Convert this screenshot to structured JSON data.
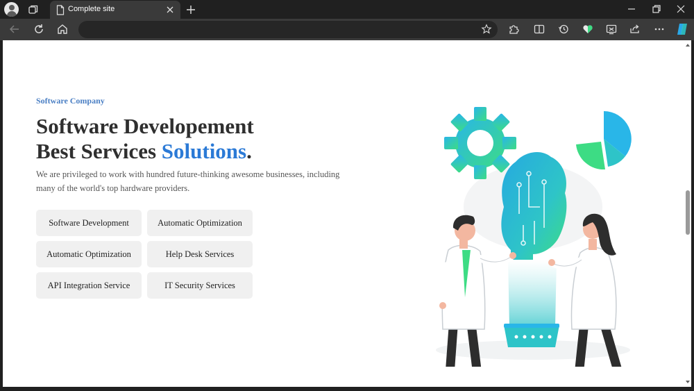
{
  "browser": {
    "tab_title": "Complete site",
    "address_value": ""
  },
  "hero": {
    "eyebrow": "Software Company",
    "heading_line1": "Software Developement",
    "heading_line2_prefix": "Best Services ",
    "heading_line2_accent": "Solutions",
    "heading_line2_suffix": ".",
    "description": "We are privileged to work with hundred future-thinking awesome businesses, including many of the world's top hardware providers."
  },
  "services": [
    "Software Development",
    "Automatic Optimization",
    "Automatic Optimization",
    "Help Desk Services",
    "API Integration Service",
    "IT Security Services"
  ],
  "colors": {
    "accent_blue": "#2b7ad6",
    "eyebrow_blue": "#4a7fc4",
    "illustration_teal": "#2ec4c8",
    "illustration_green": "#3ddc84",
    "illustration_sky": "#29b6e8"
  },
  "icons": {
    "profile": "profile-avatar-icon",
    "workspaces": "workspaces-icon",
    "tab_page": "document-icon",
    "tab_close": "close-icon",
    "new_tab": "plus-icon",
    "back": "arrow-left-icon",
    "refresh": "refresh-icon",
    "home": "home-icon",
    "favorite": "star-icon",
    "extensions": "puzzle-icon",
    "split_screen": "split-screen-icon",
    "history": "history-icon",
    "browser_essentials": "heart-icon",
    "screenshot": "web-capture-icon",
    "share": "share-icon",
    "more": "more-dots-icon",
    "copilot": "copilot-icon"
  }
}
